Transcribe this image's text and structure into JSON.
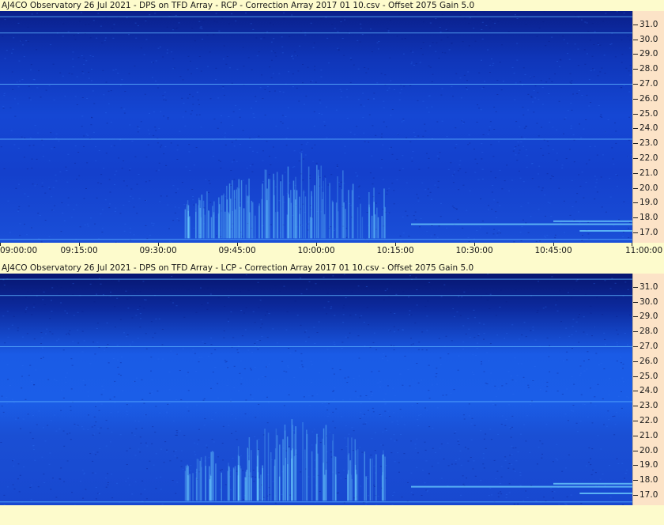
{
  "chart_data": [
    {
      "type": "heatmap",
      "title": "AJ4CO Observatory 26 Jul 2021  -  DPS on TFD Array  -  RCP  -  Correction Array 2017 01 10.csv  -  Offset 2075  Gain 5.0",
      "xlabel": "",
      "ylabel": "",
      "x_ticks": [
        "09:00:00",
        "09:15:00",
        "09:30:00",
        "09:45:00",
        "10:00:00",
        "10:15:00",
        "10:30:00",
        "10:45:00",
        "11:00:00"
      ],
      "y_ticks": [
        "17.0",
        "18.0",
        "19.0",
        "20.0",
        "21.0",
        "22.0",
        "23.0",
        "24.0",
        "25.0",
        "26.0",
        "27.0",
        "28.0",
        "29.0",
        "30.0",
        "31.0"
      ],
      "ylim": [
        16.3,
        31.9
      ],
      "xlim": [
        "09:00:00",
        "11:00:00"
      ],
      "colors": {
        "background_low": "#0b2aa0",
        "background_high": "#1a5be8",
        "emission": "#6fd3ff"
      }
    },
    {
      "type": "heatmap",
      "title": "AJ4CO Observatory 26 Jul 2021  -  DPS on TFD Array  -  LCP  -  Correction Array 2017 01 10.csv  -  Offset 2075  Gain 5.0",
      "xlabel": "",
      "ylabel": "",
      "y_ticks": [
        "17.0",
        "18.0",
        "19.0",
        "20.0",
        "21.0",
        "22.0",
        "23.0",
        "24.0",
        "25.0",
        "26.0",
        "27.0",
        "28.0",
        "29.0",
        "30.0",
        "31.0"
      ],
      "ylim": [
        16.3,
        31.9
      ],
      "xlim": [
        "09:00:00",
        "11:00:00"
      ],
      "colors": {
        "background_low": "#0b2aa0",
        "background_high": "#1a5be8",
        "emission": "#6fd3ff"
      }
    }
  ]
}
